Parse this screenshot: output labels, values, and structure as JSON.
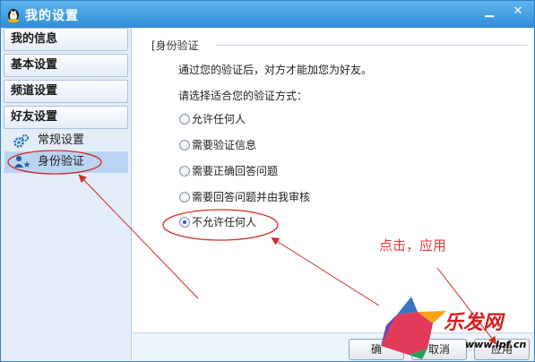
{
  "window": {
    "title": "我的设置",
    "min_icon": "minimize-icon",
    "close_icon": "close-icon"
  },
  "sidebar": {
    "categories": [
      {
        "label": "我的信息"
      },
      {
        "label": "基本设置"
      },
      {
        "label": "频道设置"
      },
      {
        "label": "好友设置"
      }
    ],
    "subitems": [
      {
        "label": "常规设置",
        "icon": "gear-icon"
      },
      {
        "label": "身份验证",
        "icon": "user-star-icon",
        "selected": true
      }
    ]
  },
  "content": {
    "section_title": "[身份验证",
    "description": "通过您的验证后，对方才能加您为好友。",
    "prompt": "请选择适合您的验证方式：",
    "options": [
      {
        "label": "允许任何人",
        "checked": false
      },
      {
        "label": "需要验证信息",
        "checked": false
      },
      {
        "label": "需要正确回答问题",
        "checked": false
      },
      {
        "label": "需要回答问题并由我审核",
        "checked": false
      },
      {
        "label": "不允许任何人",
        "checked": true
      }
    ]
  },
  "buttons": {
    "ok": "确",
    "cancel": "取消",
    "apply": "应用"
  },
  "annotation": {
    "text": "点击，应用",
    "color": "#e23b3b"
  },
  "watermark": {
    "text": "乐发网",
    "url": "www.lpf.cn"
  },
  "colors": {
    "titlebar": "#3a9be4",
    "selected_item": "#bad4f2",
    "annotation": "#e23b3b"
  }
}
